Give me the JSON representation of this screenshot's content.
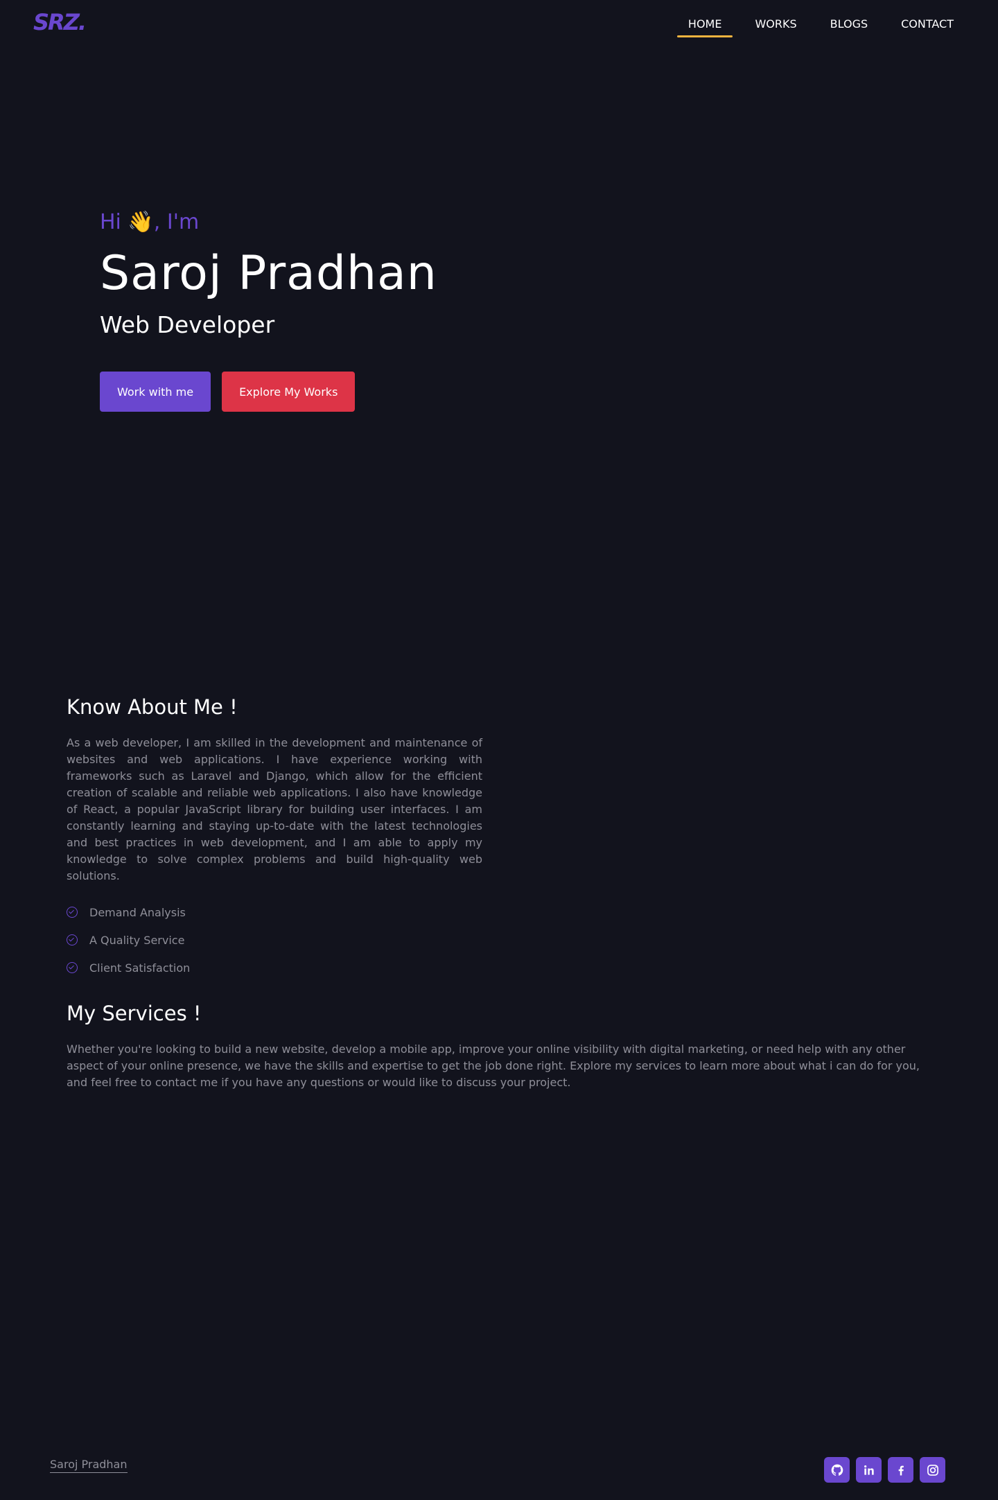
{
  "brand": {
    "logo_text": "SRZ."
  },
  "nav": {
    "items": [
      {
        "label": "HOME",
        "active": true
      },
      {
        "label": "WORKS",
        "active": false
      },
      {
        "label": "BLOGS",
        "active": false
      },
      {
        "label": "CONTACT",
        "active": false
      }
    ]
  },
  "hero": {
    "greeting": "Hi 👋, I'm",
    "name": "Saroj Pradhan",
    "role": "Web Developer",
    "primary_button": "Work with me",
    "secondary_button": "Explore My Works"
  },
  "about": {
    "title": "Know About Me !",
    "text": "As a web developer, I am skilled in the development and maintenance of websites and web applications. I have experience working with frameworks such as Laravel and Django, which allow for the efficient creation of scalable and reliable web applications. I also have knowledge of React, a popular JavaScript library for building user interfaces. I am constantly learning and staying up-to-date with the latest technologies and best practices in web development, and I am able to apply my knowledge to solve complex problems and build high-quality web solutions.",
    "features": [
      "Demand Analysis",
      "A Quality Service",
      "Client Satisfaction"
    ]
  },
  "services": {
    "title": "My Services !",
    "text": "Whether you're looking to build a new website, develop a mobile app, improve your online visibility with digital marketing, or need help with any other aspect of your online presence, we have the skills and expertise to get the job done right. Explore my services to learn more about what i can do for you, and feel free to contact me if you have any questions or would like to discuss your project."
  },
  "footer": {
    "name_link": "Saroj Pradhan",
    "socials": [
      "github-icon",
      "linkedin-icon",
      "facebook-icon",
      "instagram-icon"
    ]
  },
  "colors": {
    "background": "#12131d",
    "accent": "#6a47cf",
    "danger": "#dd3447",
    "nav_underline": "#f3b43f",
    "muted_text": "#8f8f99"
  }
}
